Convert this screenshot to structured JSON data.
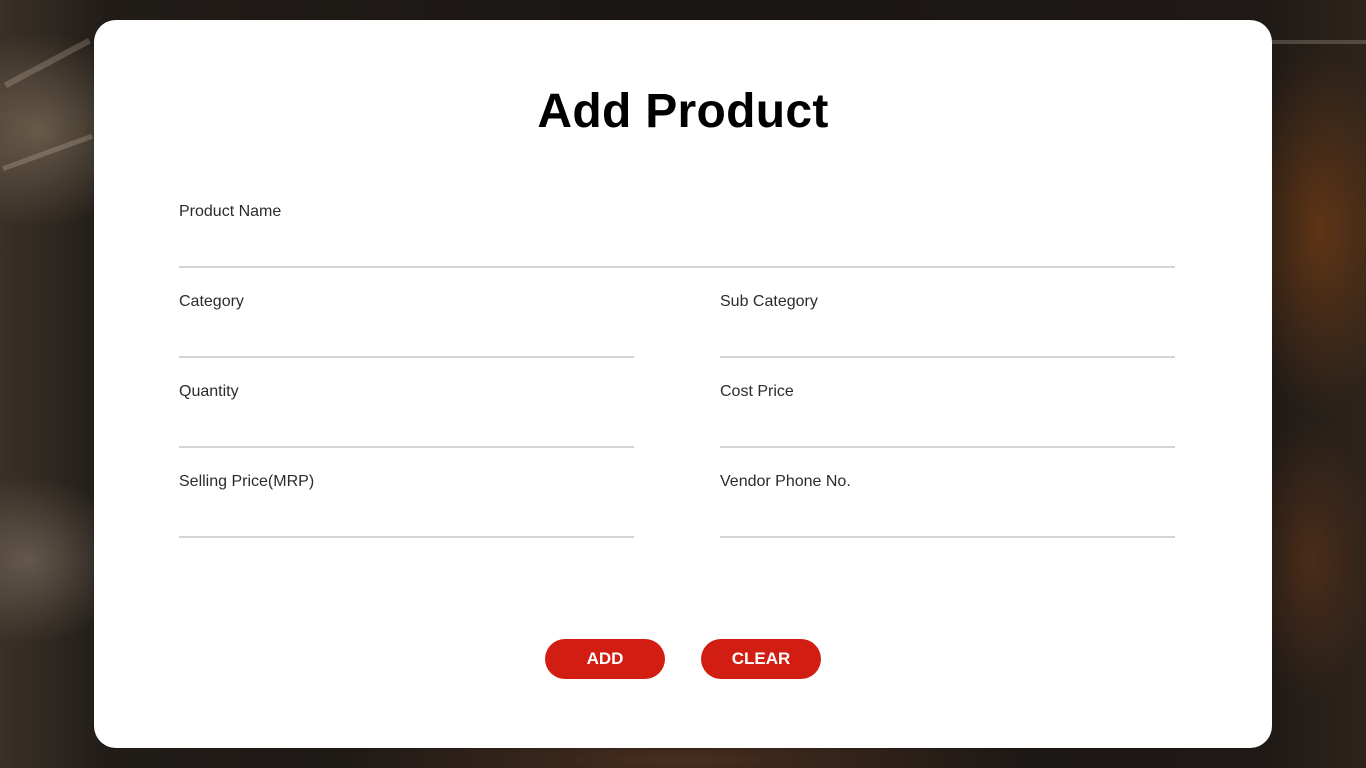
{
  "form": {
    "title": "Add Product",
    "fields": {
      "product_name": {
        "label": "Product Name",
        "value": ""
      },
      "category": {
        "label": "Category",
        "value": ""
      },
      "sub_category": {
        "label": "Sub Category",
        "value": ""
      },
      "quantity": {
        "label": "Quantity",
        "value": ""
      },
      "cost_price": {
        "label": "Cost Price",
        "value": ""
      },
      "selling_price": {
        "label": "Selling Price(MRP)",
        "value": ""
      },
      "vendor_phone": {
        "label": "Vendor Phone No.",
        "value": ""
      }
    },
    "buttons": {
      "add": "ADD",
      "clear": "CLEAR"
    }
  },
  "colors": {
    "accent": "#d21e12",
    "card": "#ffffff",
    "underline": "#d4d4d4"
  }
}
